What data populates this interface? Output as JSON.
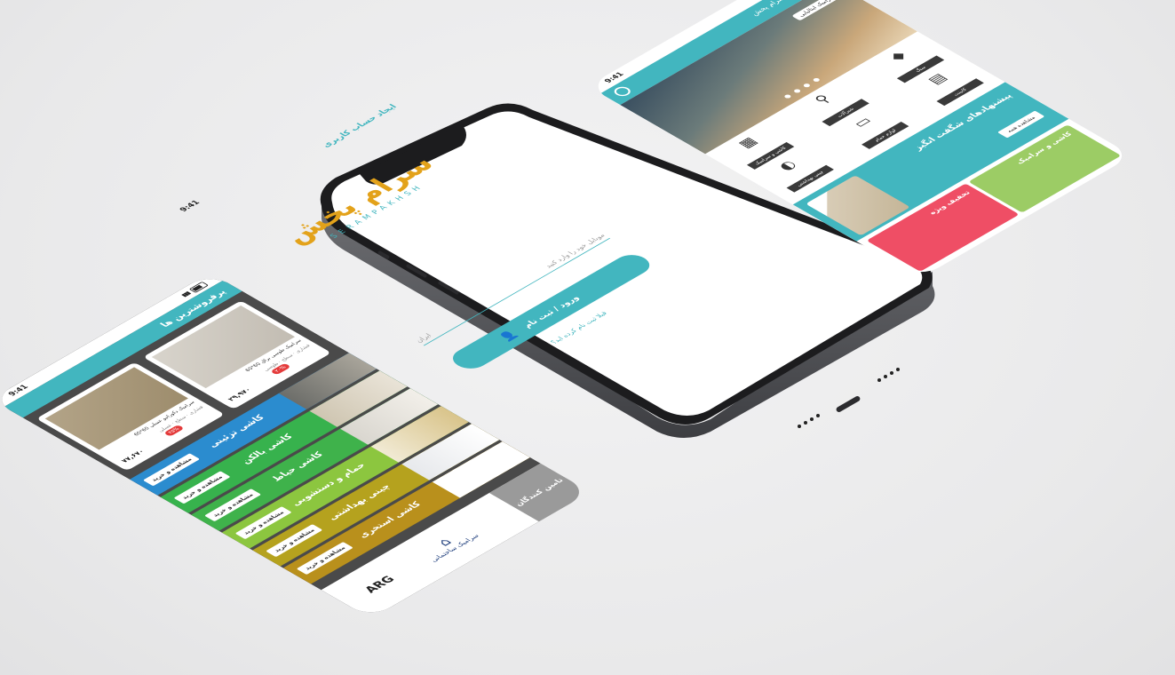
{
  "left_phone": {
    "status_time": "9:41",
    "section_title": "پرفروشترین ها",
    "products": [
      {
        "title": "سرامیک دکوراتیو عسلی 60*60",
        "meta": "فشاری · سطح · عسلی",
        "price": "۷۷,۶۷۰",
        "old_price": "",
        "discount": "۲۵%"
      },
      {
        "title": "سرامیک طوسی براق 60*60",
        "meta": "فشاری · سطح · طوسی",
        "price": "۲۹,۹۷۰",
        "old_price": "",
        "discount": "۲۰%"
      }
    ],
    "categories": [
      {
        "name": "کاشی تزئینی",
        "button": "مشاهده و خرید",
        "color": "#2b8ccf"
      },
      {
        "name": "کاشی بالکن",
        "button": "مشاهده و خرید",
        "color": "#37b24d"
      },
      {
        "name": "کاشی حیاط",
        "button": "مشاهده و خرید",
        "color": "#3fb24b"
      },
      {
        "name": "حمام و دستشویی",
        "button": "مشاهده و خرید",
        "color": "#8cc63f"
      },
      {
        "name": "چینی بهداشتی",
        "button": "مشاهده و خرید",
        "color": "#b5a21e"
      },
      {
        "name": "کاشی استخری",
        "button": "مشاهده و خرید",
        "color": "#b9901c"
      }
    ],
    "suppliers_title": "تامین کنندگان",
    "suppliers": [
      "ARG",
      "سرامیک ساختمانی"
    ]
  },
  "center_phone": {
    "status_time": "9:41",
    "signup_header": "ایجاد حساب کاربری",
    "brand_fa": "سرام پخش",
    "brand_en": "SERAMPAKHSH",
    "phone_label": "ایران",
    "phone_placeholder": "موبایل خود را وارد کنید",
    "login_button": "ورود / ثبت نام",
    "forgot_link": "قبلا ثبت نام کرده اید؟"
  },
  "right_phone": {
    "status_time": "9:41",
    "search_placeholder": "جستجو در سرام پخش",
    "hero_tag": "سرامیک ایتالیایی",
    "hero_dots": "● ● ● ●",
    "categories": [
      {
        "label": "کاشی و سرامیک",
        "icon": "tiles-icon"
      },
      {
        "label": "شیرآلات",
        "icon": "faucet-icon"
      },
      {
        "label": "سنگ",
        "icon": "stone-icon"
      },
      {
        "label": "چینی بهداشتی",
        "icon": "toilet-icon"
      },
      {
        "label": "لوازم حمام",
        "icon": "bath-icon"
      },
      {
        "label": "کابینت",
        "icon": "cabinet-icon"
      }
    ],
    "promo_title": "پیشنهادهای شگفت انگیز",
    "promo_cta": "مشاهده همه",
    "banners": [
      {
        "text": "تخفیف ویژه",
        "color": "#ef4e65"
      },
      {
        "text": "کاشی و سرامیک",
        "color": "#9ccc65"
      }
    ]
  },
  "colors": {
    "accent": "#42b6bf",
    "brand_orange": "#e3a21a",
    "dark": "#4a4a4a"
  }
}
